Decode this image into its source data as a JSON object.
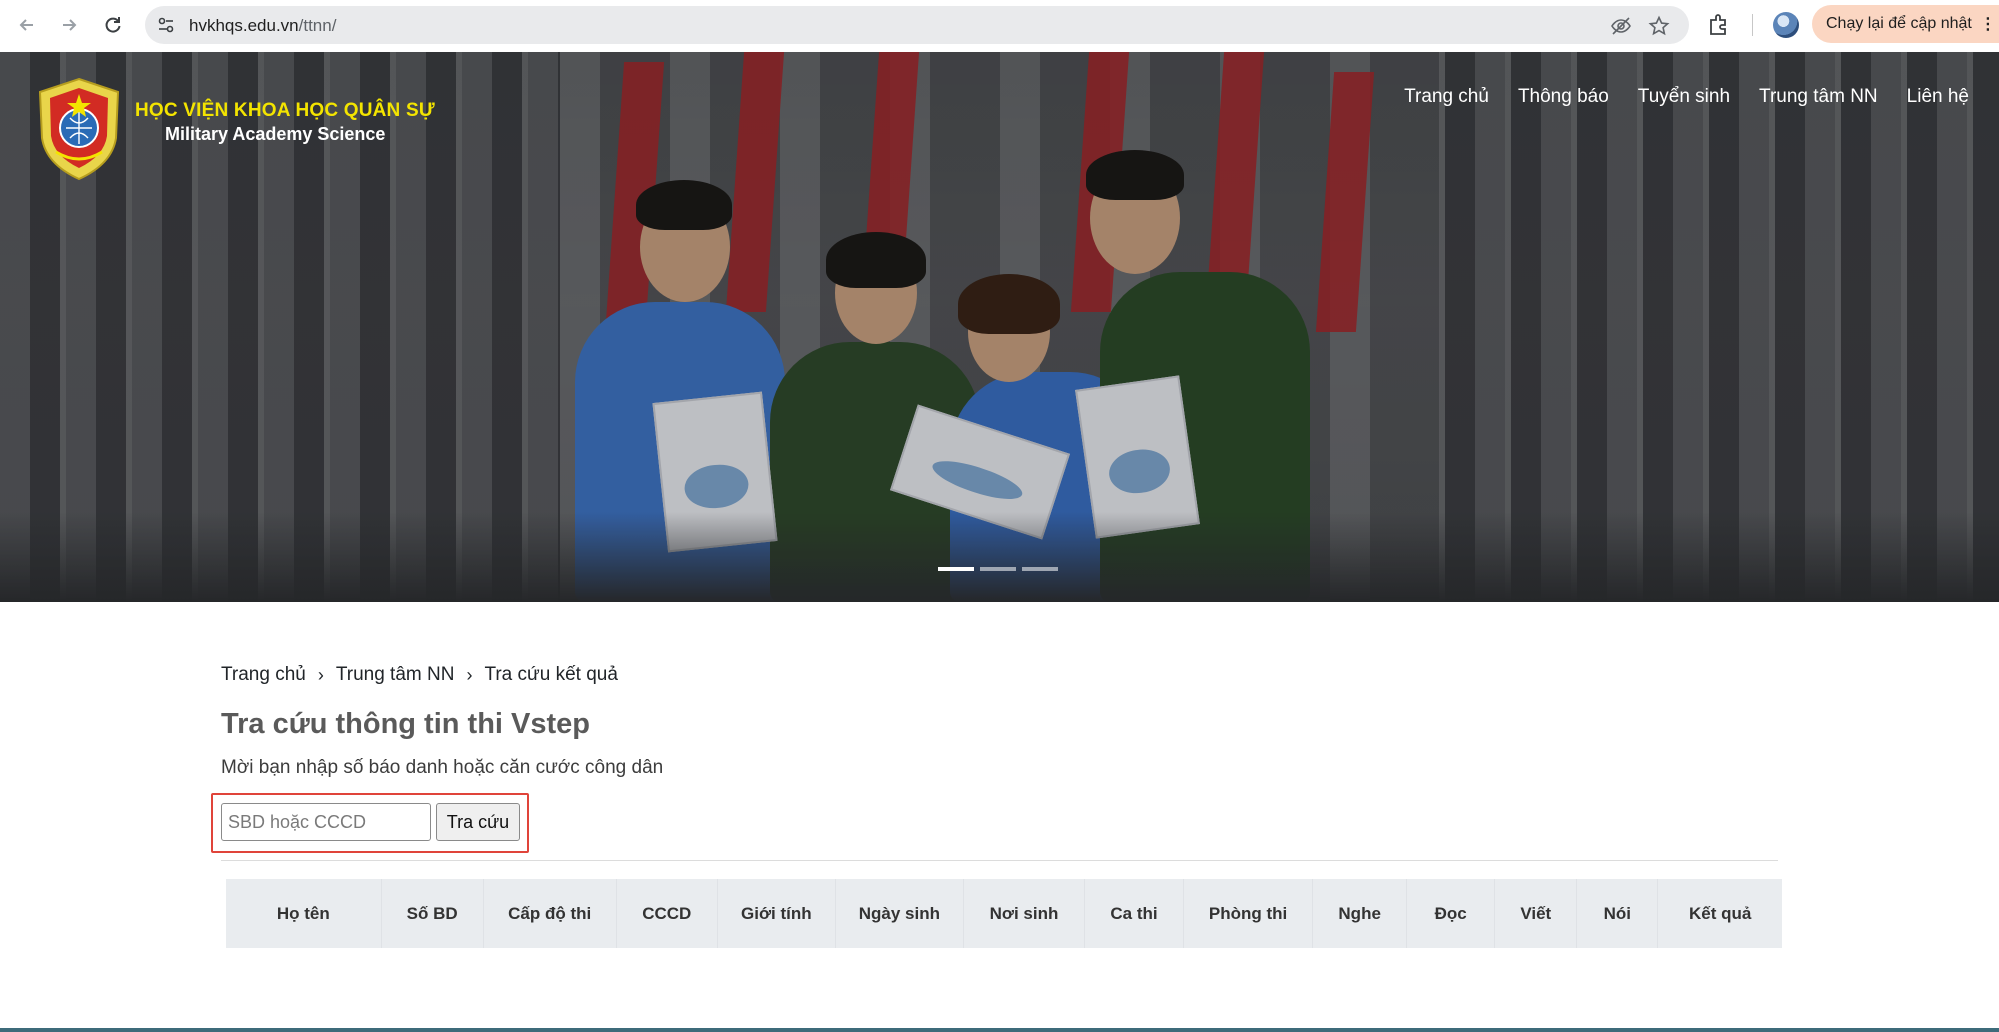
{
  "browser": {
    "url_host": "hvkhqs.edu.vn",
    "url_path": "/ttnn/",
    "update_label": "Chạy lại để cập nhật",
    "menu_dots": "⋮"
  },
  "header": {
    "brand_vn": "HỌC VIỆN KHOA HỌC QUÂN SỰ",
    "brand_en": "Military Academy Science",
    "nav": [
      "Trang chủ",
      "Thông báo",
      "Tuyển sinh",
      "Trung tâm NN",
      "Liên hệ"
    ]
  },
  "carousel": {
    "slides": 3,
    "active": 0
  },
  "breadcrumb": [
    "Trang chủ",
    "Trung tâm NN",
    "Tra cứu kết quả"
  ],
  "breadcrumb_sep": "›",
  "page": {
    "title": "Tra cứu thông tin thi Vstep",
    "instruction": "Mời bạn nhập số báo danh hoặc căn cước công dân"
  },
  "search": {
    "placeholder": "SBD hoặc CCCD",
    "value": "",
    "button_label": "Tra cứu"
  },
  "table": {
    "headers": [
      "Họ tên",
      "Số BD",
      "Cấp độ thi",
      "CCCD",
      "Giới tính",
      "Ngày sinh",
      "Nơi sinh",
      "Ca thi",
      "Phòng thi",
      "Nghe",
      "Đọc",
      "Viết",
      "Nói",
      "Kết quả"
    ]
  },
  "colors": {
    "brand_yellow": "#f3e400",
    "highlight_border": "#e0443a",
    "table_header_bg": "#e9ecef"
  }
}
